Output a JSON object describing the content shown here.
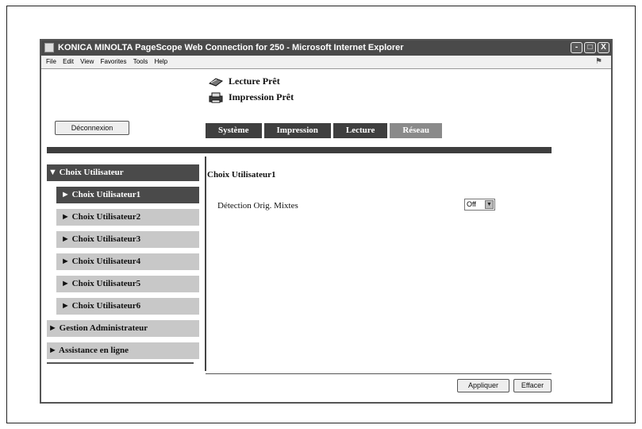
{
  "window": {
    "title": "KONICA MINOLTA PageScope Web Connection for 250 - Microsoft Internet Explorer",
    "controls": [
      "-",
      "□",
      "X"
    ]
  },
  "menubar": [
    "File",
    "Edit",
    "View",
    "Favorites",
    "Tools",
    "Help"
  ],
  "status": {
    "scan": "Lecture Prêt",
    "print": "Impression Prêt"
  },
  "logout_label": "Déconnexion",
  "tabs": [
    "Système",
    "Impression",
    "Lecture",
    "Réseau"
  ],
  "sidebar": {
    "user_choice": "Choix Utilisateur",
    "sub_items": [
      "Choix Utilisateur1",
      "Choix Utilisateur2",
      "Choix Utilisateur3",
      "Choix Utilisateur4",
      "Choix Utilisateur5",
      "Choix Utilisateur6"
    ],
    "admin": "Gestion Administrateur",
    "help": "Assistance en ligne",
    "expanded_arrow": "▼",
    "collapsed_arrow": "►"
  },
  "main": {
    "title": "Choix Utilisateur1",
    "field_label": "Détection Orig. Mixtes",
    "field_value": "Off"
  },
  "buttons": {
    "apply": "Appliquer",
    "clear": "Effacer"
  },
  "colors": {
    "tab_bg": "#3f3f3f",
    "tab_network_bg": "#8a8a8a",
    "active_item_bg": "#4a4a4a",
    "item_bg": "#c8c8c8"
  }
}
